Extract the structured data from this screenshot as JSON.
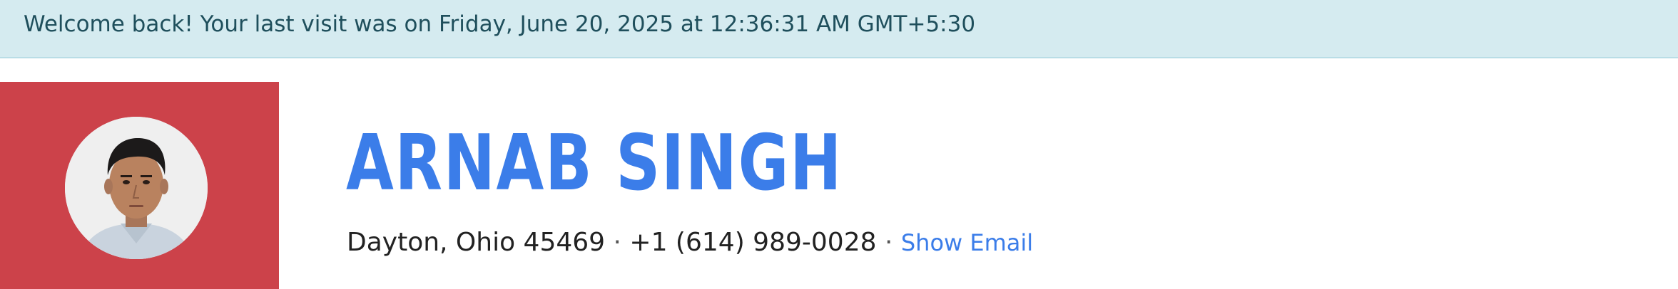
{
  "banner": {
    "message": "Welcome back! Your last visit was on Friday, June 20, 2025 at 12:36:31 AM GMT+5:30"
  },
  "profile": {
    "name": "ARNAB SINGH",
    "location": "Dayton, Ohio 45469",
    "separator": " · ",
    "phone": "+1 (614) 989-0028",
    "email_link_label": "Show Email",
    "avatar_icon": "profile-photo"
  },
  "colors": {
    "banner_bg": "#d5ebf0",
    "banner_text": "#1f4f5c",
    "sidebar_bg": "#cc424a",
    "name": "#3b7de9",
    "link": "#3b7de9"
  }
}
